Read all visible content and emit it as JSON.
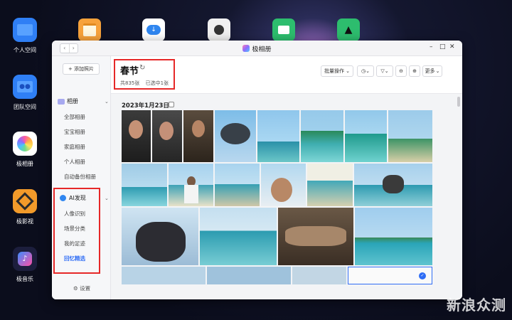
{
  "desktop": {
    "icons": [
      {
        "label": "个人空间",
        "icon": "folder-icon",
        "color": "#2f7ff5"
      },
      {
        "label": "团队空间",
        "icon": "team-folder-icon",
        "color": "#2f7ff5"
      },
      {
        "label": "极相册",
        "icon": "photos-icon",
        "color": "#ffffff"
      },
      {
        "label": "极影视",
        "icon": "video-icon",
        "color": "#f29a2a"
      },
      {
        "label": "极音乐",
        "icon": "music-icon",
        "color": "#1c1e3d"
      }
    ],
    "top_icons": [
      "notes-icon",
      "cloud-download-icon",
      "contacts-icon",
      "backup-icon",
      "education-icon"
    ],
    "watermark": "新浪众测"
  },
  "window": {
    "title": "极相册",
    "controls": [
      "–",
      "□",
      "✕"
    ]
  },
  "sidebar": {
    "add_photo": "+ 添加照片",
    "albums_header": "相册",
    "albums": [
      "全部相册",
      "宝宝相册",
      "家庭相册",
      "个人相册",
      "自动备份相册"
    ],
    "ai_header": "AI发现",
    "ai_items": [
      "人像识别",
      "场景分类",
      "我的足迹",
      "回忆精选"
    ],
    "active_item": "回忆精选",
    "settings": "设置"
  },
  "main": {
    "title": "春节",
    "refresh_icon": "↻",
    "total": "共835张",
    "selected": "已选中1张",
    "toolbar": {
      "batch": "批量操作",
      "more": "更多"
    },
    "date_group": "2023年1月23日"
  },
  "colors": {
    "accent": "#2f6df5",
    "highlight_box": "#e62828"
  }
}
